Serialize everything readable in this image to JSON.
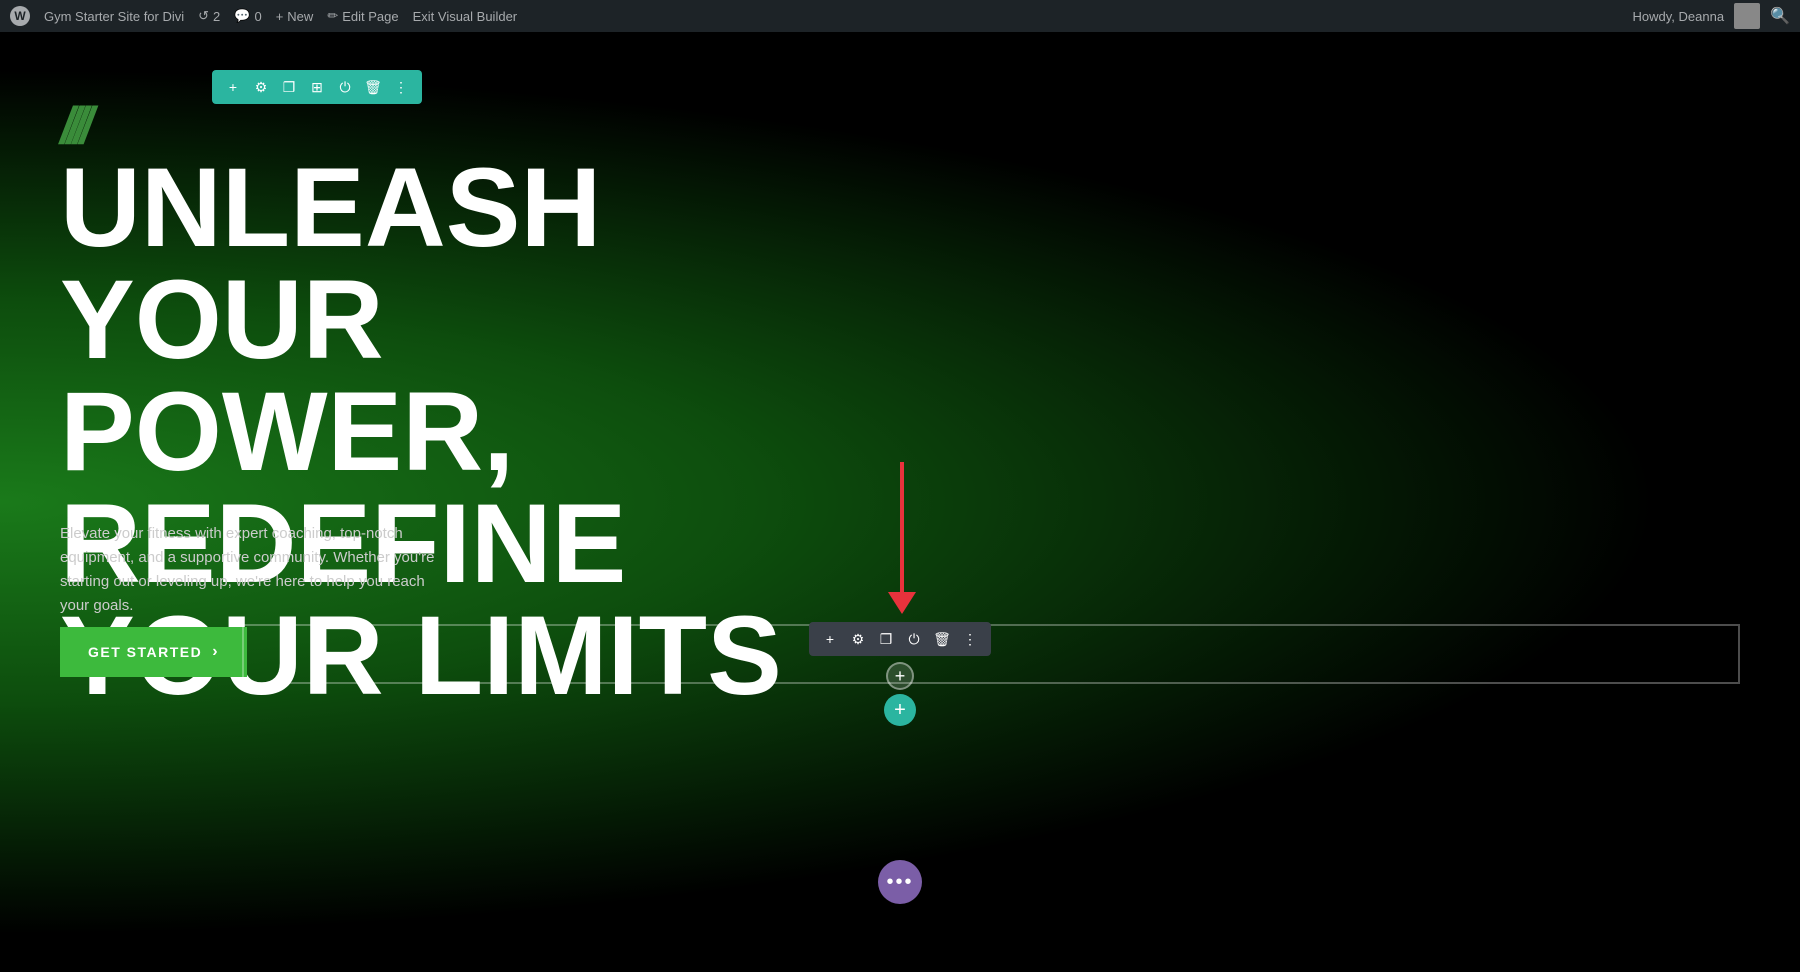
{
  "adminBar": {
    "wpLogo": "W",
    "siteName": "Gym Starter Site for Divi",
    "historyCount": "2",
    "commentsCount": "0",
    "newLabel": "New",
    "editPageLabel": "Edit Page",
    "exitBuilderLabel": "Exit Visual Builder",
    "howdyLabel": "Howdy, Deanna"
  },
  "hero": {
    "slashDeco": "////",
    "headline": "UNLEASH YOUR POWER, REDEFINE YOUR LIMITS",
    "subtext": "Elevate your fitness with expert coaching, top-notch equipment, and a supportive community. Whether you're starting out or leveling up, we're here to help you reach your goals.",
    "ctaLabel": "GET STARTED",
    "ctaArrow": "›"
  },
  "toolbar": {
    "addIcon": "+",
    "settingsIcon": "⚙",
    "duplicateIcon": "❐",
    "columnsIcon": "⊞",
    "disableIcon": "⏻",
    "deleteIcon": "🗑",
    "moreIcon": "⋮"
  },
  "buttons": {
    "plusSmall": "+",
    "plusTeal": "+",
    "dotsLabel": "•••"
  }
}
